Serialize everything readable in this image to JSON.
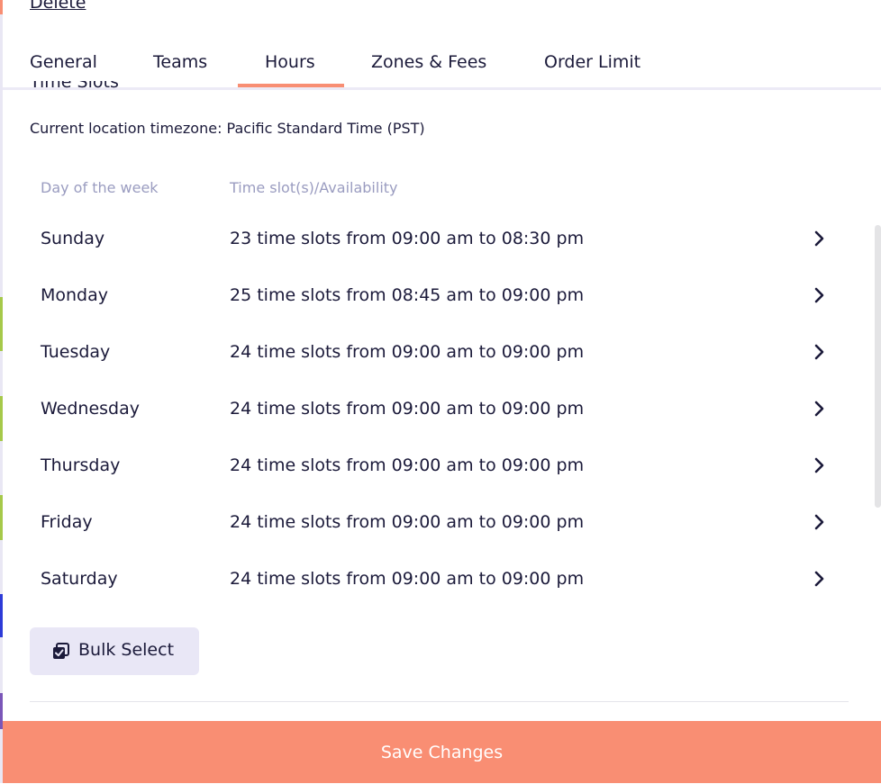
{
  "header": {
    "delete_label": "Delete"
  },
  "tabs": [
    {
      "label": "General"
    },
    {
      "label": "Teams"
    },
    {
      "label": "Hours",
      "active": true
    },
    {
      "label": "Zones & Fees"
    },
    {
      "label": "Order Limit"
    }
  ],
  "section": {
    "title": "Time Slots",
    "timezone_text": "Current location timezone: Pacific Standard Time (PST)"
  },
  "table": {
    "headers": [
      "Day of the week",
      "Time slot(s)/Availability"
    ],
    "rows": [
      {
        "day": "Sunday",
        "slots": "23 time slots from 09:00 am to 08:30 pm"
      },
      {
        "day": "Monday",
        "slots": "25 time slots from 08:45 am to 09:00 pm"
      },
      {
        "day": "Tuesday",
        "slots": "24 time slots from 09:00 am to 09:00 pm"
      },
      {
        "day": "Wednesday",
        "slots": "24 time slots from 09:00 am to 09:00 pm"
      },
      {
        "day": "Thursday",
        "slots": "24 time slots from 09:00 am to 09:00 pm"
      },
      {
        "day": "Friday",
        "slots": "24 time slots from 09:00 am to 09:00 pm"
      },
      {
        "day": "Saturday",
        "slots": "24 time slots from 09:00 am to 09:00 pm"
      }
    ]
  },
  "bulk_select": {
    "label": "Bulk Select",
    "icon": "bulk-select-icon"
  },
  "footer": {
    "save_label": "Save Changes"
  },
  "colors": {
    "accent": "#f98e73",
    "text": "#1b1a3a",
    "muted": "#9a9cc0",
    "button_bg": "#e9e7f6"
  }
}
